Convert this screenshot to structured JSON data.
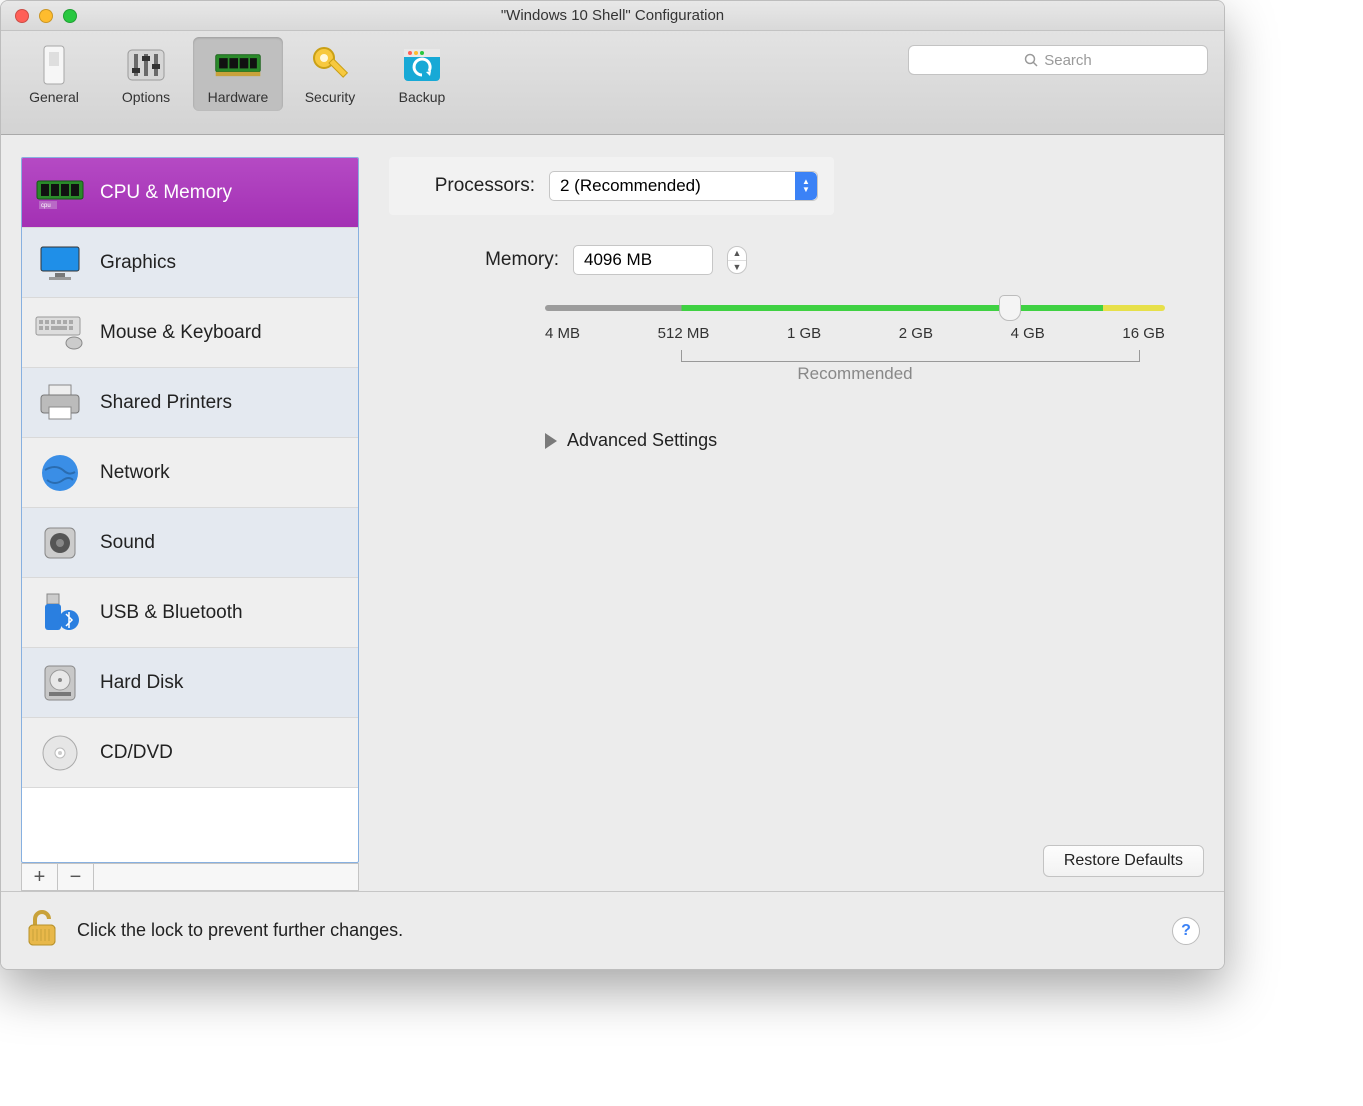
{
  "title": "\"Windows 10 Shell\" Configuration",
  "toolbar": {
    "items": [
      {
        "label": "General"
      },
      {
        "label": "Options"
      },
      {
        "label": "Hardware"
      },
      {
        "label": "Security"
      },
      {
        "label": "Backup"
      }
    ],
    "search_placeholder": "Search"
  },
  "sidebar": {
    "items": [
      {
        "label": "CPU & Memory"
      },
      {
        "label": "Graphics"
      },
      {
        "label": "Mouse & Keyboard"
      },
      {
        "label": "Shared Printers"
      },
      {
        "label": "Network"
      },
      {
        "label": "Sound"
      },
      {
        "label": "USB & Bluetooth"
      },
      {
        "label": "Hard Disk"
      },
      {
        "label": "CD/DVD"
      }
    ]
  },
  "main": {
    "processors_label": "Processors:",
    "processors_value": "2 (Recommended)",
    "memory_label": "Memory:",
    "memory_value": "4096 MB",
    "slider_ticks": [
      "4 MB",
      "512 MB",
      "1 GB",
      "2 GB",
      "4 GB",
      "16 GB"
    ],
    "recommended_label": "Recommended",
    "advanced_label": "Advanced Settings",
    "restore_label": "Restore Defaults"
  },
  "footer": {
    "lock_text": "Click the lock to prevent further changes."
  }
}
